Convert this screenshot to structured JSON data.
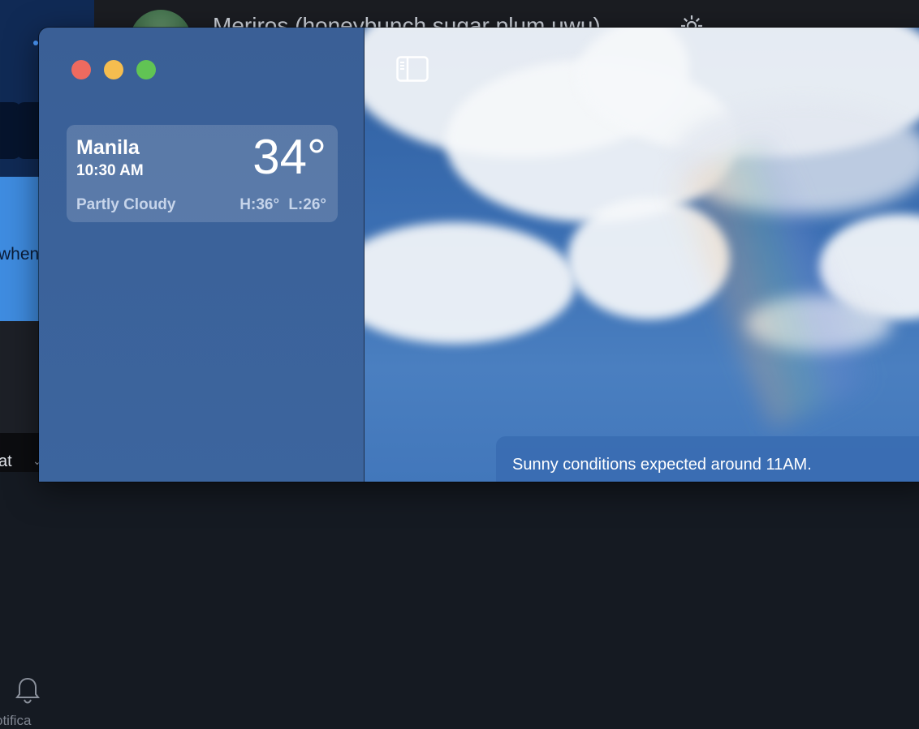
{
  "background_app": {
    "title": "Meriros (honeybunch sugar plum uwu)",
    "partial_text_when": "when",
    "partial_text_notifications": "otifica",
    "partial_text_chat": "at",
    "icons": [
      "gear-icon",
      "bell-icon",
      "avatar"
    ]
  },
  "weather_window": {
    "window_controls": [
      "close",
      "minimize",
      "zoom"
    ],
    "toolbar": {
      "sidebar_toggle_icon": "sidebar-toggle-icon"
    },
    "locations": [
      {
        "city": "Manila",
        "time": "10:30 AM",
        "temperature": "34°",
        "condition": "Partly Cloudy",
        "high_low": "H:36° L:26°"
      }
    ],
    "forecast_banner": "Sunny conditions expected around 11AM."
  },
  "colors": {
    "close": "#ee6a5f",
    "minimize": "#f5bd4f",
    "zoom": "#61c454",
    "sidebar": "#3a5f96",
    "sky": "#3b6fb3"
  }
}
